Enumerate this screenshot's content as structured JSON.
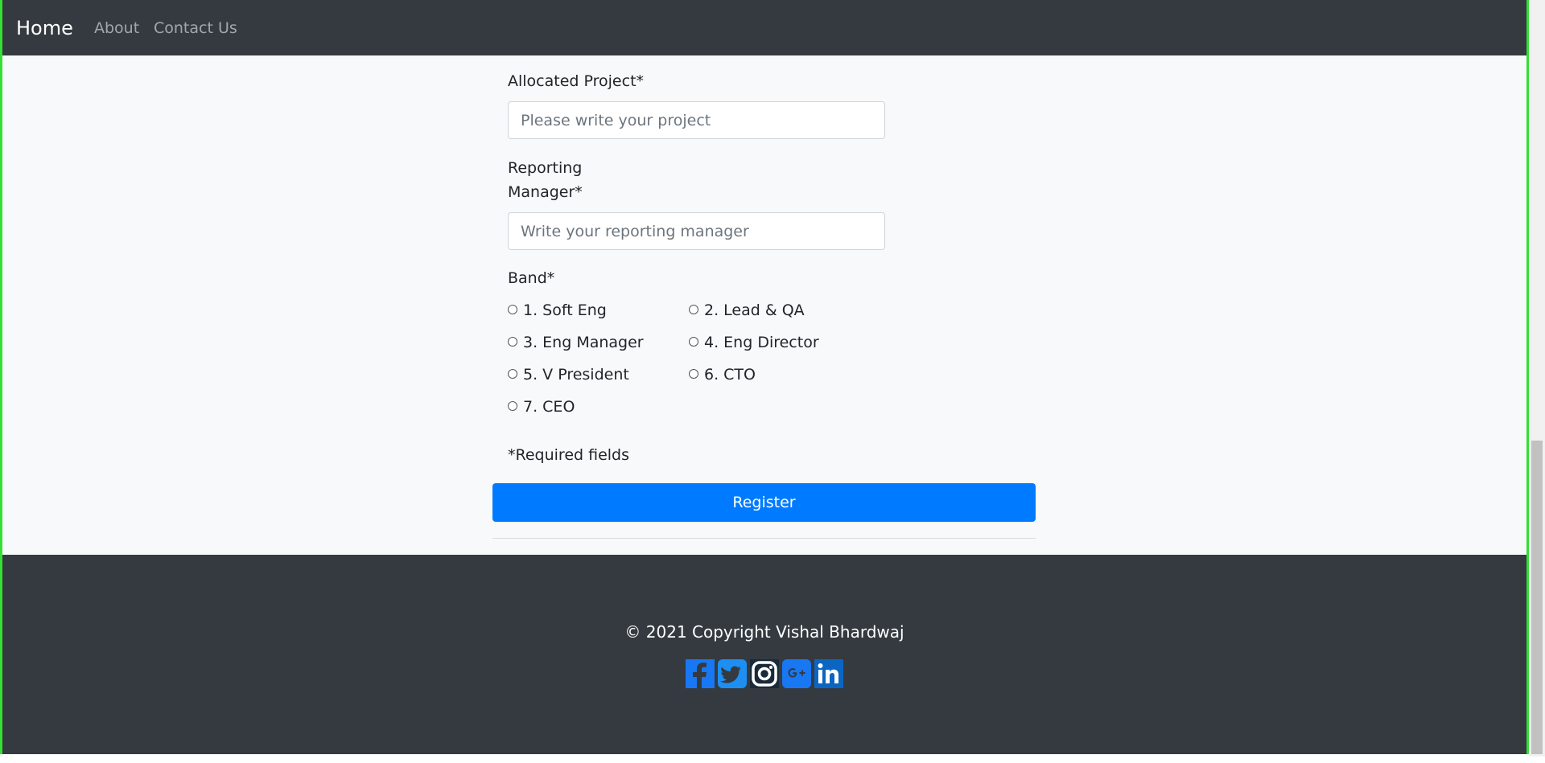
{
  "nav": {
    "brand": "Home",
    "links": [
      "About",
      "Contact Us"
    ]
  },
  "form": {
    "project_label": "Allocated Project*",
    "project_placeholder": "Please write your project",
    "manager_label_line1": "Reporting",
    "manager_label_line2": "Manager*",
    "manager_placeholder": "Write your reporting manager",
    "band_label": "Band*",
    "band_options": [
      "1. Soft Eng",
      "2. Lead & QA",
      "3. Eng Manager",
      "4. Eng Director",
      "5. V President",
      "6. CTO",
      "7. CEO"
    ],
    "required_note": "*Required fields",
    "register_label": "Register"
  },
  "footer": {
    "copyright": "© 2021 Copyright Vishal Bhardwaj",
    "social_icons": [
      "facebook-icon",
      "twitter-icon",
      "instagram-icon",
      "google-plus-icon",
      "linkedin-icon"
    ]
  },
  "colors": {
    "navbar_bg": "#343a40",
    "primary": "#007bff",
    "page_bg": "#f8f9fa",
    "frame_border": "#33e033"
  }
}
